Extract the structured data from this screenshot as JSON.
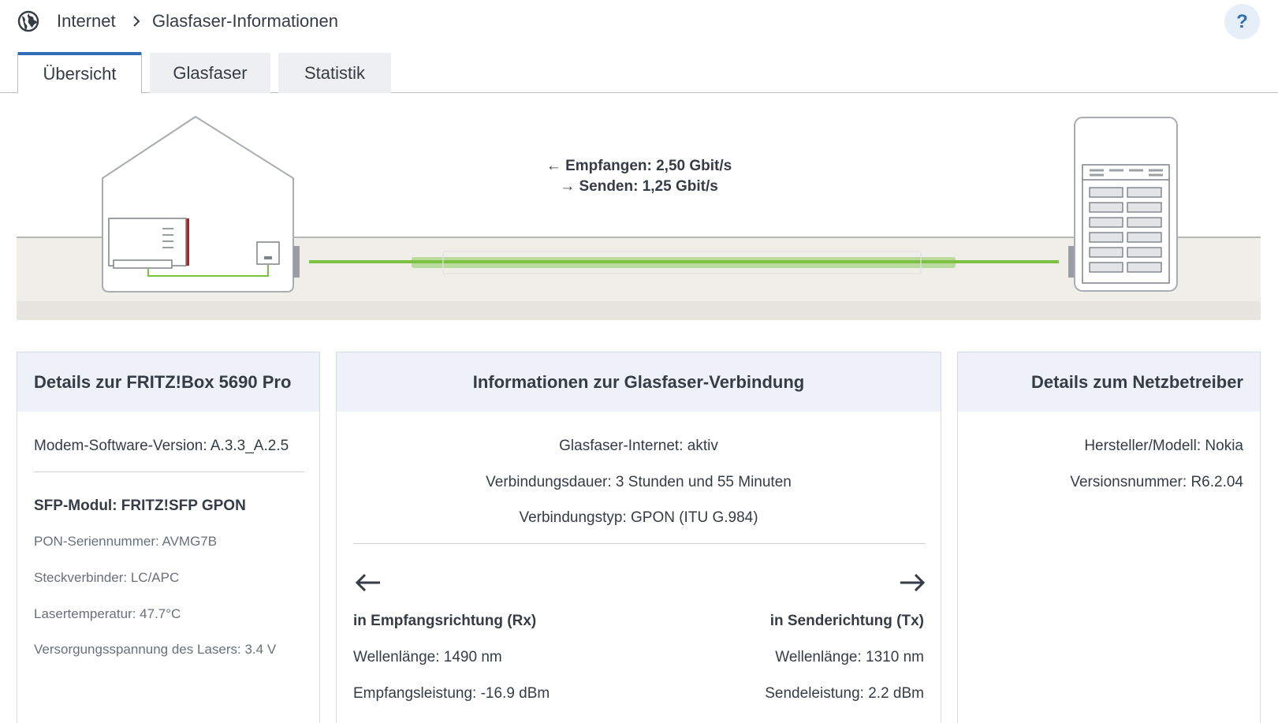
{
  "breadcrumb": {
    "root": "Internet",
    "page": "Glasfaser-Informationen"
  },
  "help_label": "?",
  "tabs": [
    {
      "label": "Übersicht",
      "active": true
    },
    {
      "label": "Glasfaser",
      "active": false
    },
    {
      "label": "Statistik",
      "active": false
    }
  ],
  "diagram": {
    "receive": "Empfangen: 2,50 Gbit/s",
    "send": "Senden: 1,25 Gbit/s"
  },
  "fritzbox": {
    "title": "Details zur FRITZ!Box 5690 Pro",
    "modem_version": "Modem-Software-Version: A.3.3_A.2.5",
    "sfp_title": "SFP-Modul: FRITZ!SFP GPON",
    "pon_serial": "PON-Seriennummer: AVMG7B",
    "connector": "Steckverbinder: LC/APC",
    "laser_temp": "Lasertemperatur: 47.7°C",
    "laser_voltage": "Versorgungsspannung des Lasers: 3.4 V"
  },
  "connection": {
    "title": "Informationen zur Glasfaser-Verbindung",
    "status": "Glasfaser-Internet: aktiv",
    "duration": "Verbindungsdauer: 3 Stunden und 55 Minuten",
    "type": "Verbindungstyp: GPON (ITU G.984)",
    "rx": {
      "title": "in Empfangsrichtung (Rx)",
      "wavelength": "Wellenlänge: 1490 nm",
      "power": "Empfangsleistung: -16.9 dBm"
    },
    "tx": {
      "title": "in Senderichtung (Tx)",
      "wavelength": "Wellenlänge: 1310 nm",
      "power": "Sendeleistung: 2.2 dBm"
    }
  },
  "operator": {
    "title": "Details zum Netzbetreiber",
    "model": "Hersteller/Modell: Nokia",
    "version": "Versionsnummer: R6.2.04"
  },
  "colors": {
    "accent": "#2f6db7",
    "fiber": "#7cc242",
    "card_header": "#eef2f8",
    "ground": "#efeee9"
  }
}
